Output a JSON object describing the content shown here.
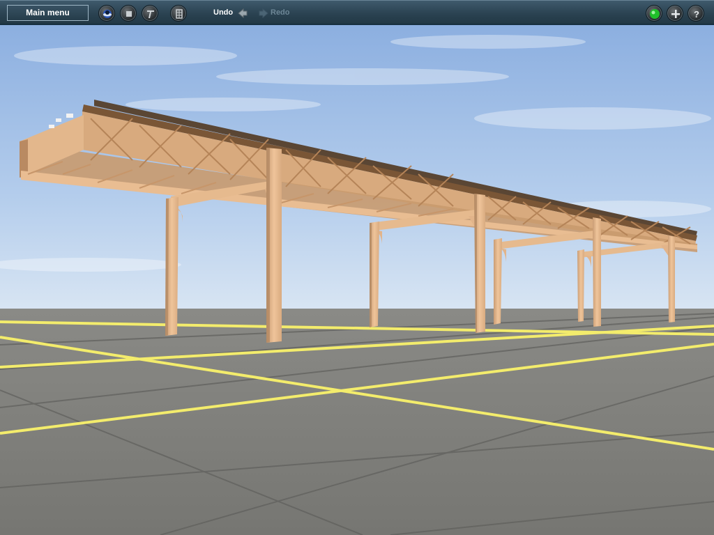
{
  "toolbar": {
    "main_menu_label": "Main menu",
    "tools": [
      {
        "icon": "globe-icon"
      },
      {
        "icon": "stop-icon"
      },
      {
        "icon": "tools-icon"
      },
      {
        "icon": "spreadsheet-icon"
      }
    ],
    "undo_label": "Undo",
    "redo_label": "Redo",
    "right_buttons": [
      {
        "icon": "green-status-icon"
      },
      {
        "icon": "plus-icon"
      },
      {
        "icon": "help-icon"
      }
    ]
  },
  "scene": {
    "sky_color_top": "#8fb0df",
    "sky_color_bottom": "#cfe0f2",
    "ground_color": "#7c7c78",
    "grid_line_color": "#f2ec6e",
    "structure_color": "#e0b48a"
  }
}
